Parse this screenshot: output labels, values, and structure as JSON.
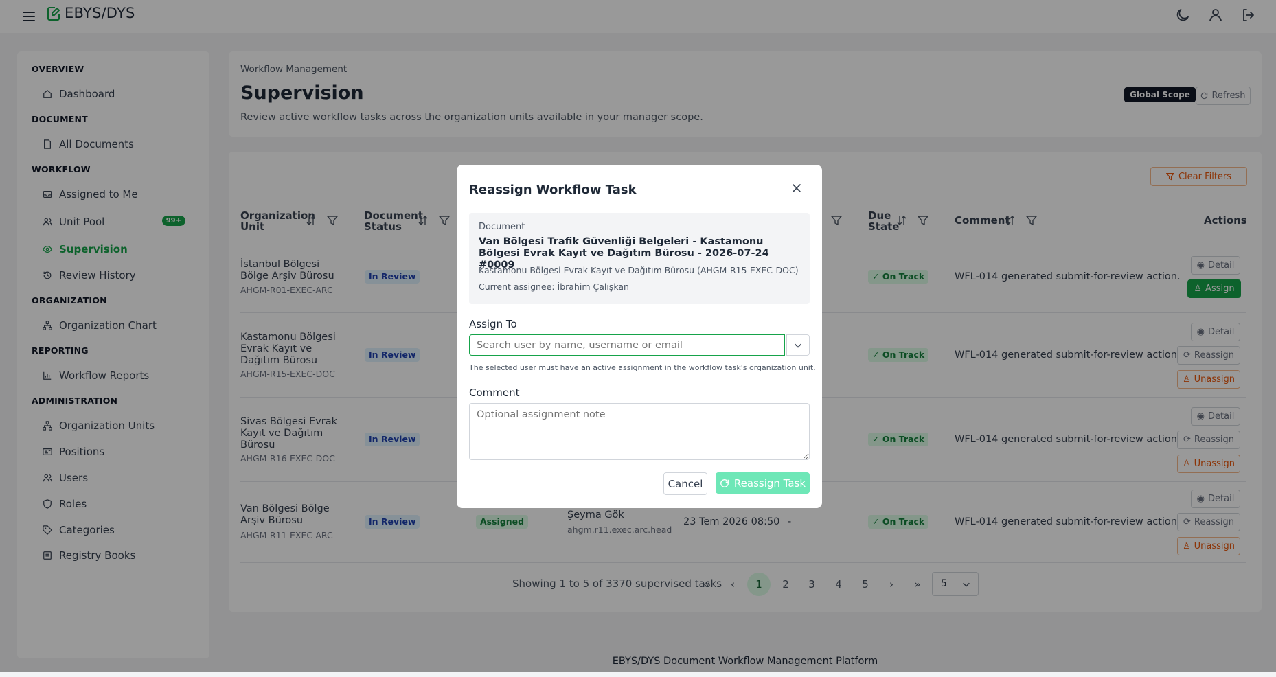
{
  "app": {
    "title": "EBYS/DYS"
  },
  "sidebar": {
    "sections": [
      {
        "title": "OVERVIEW"
      },
      {
        "title": "DOCUMENT"
      },
      {
        "title": "WORKFLOW"
      },
      {
        "title": "ORGANIZATION"
      },
      {
        "title": "REPORTING"
      },
      {
        "title": "ADMINISTRATION"
      }
    ],
    "items": [
      {
        "label": "Dashboard",
        "icon": "home-icon"
      },
      {
        "label": "All Documents",
        "icon": "document-icon"
      },
      {
        "label": "Assigned to Me",
        "icon": "inbox-icon"
      },
      {
        "label": "Unit Pool",
        "icon": "users-icon",
        "badge": "99+"
      },
      {
        "label": "Supervision",
        "icon": "eye-icon",
        "active": true
      },
      {
        "label": "Review History",
        "icon": "history-icon"
      },
      {
        "label": "Organization Chart",
        "icon": "org-chart-icon"
      },
      {
        "label": "Workflow Reports",
        "icon": "bar-chart-icon"
      },
      {
        "label": "Organization Units",
        "icon": "org-chart-icon"
      },
      {
        "label": "Positions",
        "icon": "id-card-icon"
      },
      {
        "label": "Users",
        "icon": "users-icon"
      },
      {
        "label": "Roles",
        "icon": "shield-icon"
      },
      {
        "label": "Categories",
        "icon": "tag-icon"
      },
      {
        "label": "Registry Books",
        "icon": "book-icon"
      }
    ]
  },
  "page": {
    "breadcrumb": "Workflow Management",
    "title": "Supervision",
    "description": "Review active workflow tasks across the organization units available in your manager scope.",
    "scope_badge": "Global Scope",
    "refresh_label": "Refresh",
    "clear_filters_label": "Clear Filters"
  },
  "table": {
    "columns": {
      "org_unit": "Organization Unit",
      "doc_status": "Document Status",
      "due_state": "Due State",
      "comment": "Comment",
      "actions": "Actions"
    },
    "rows": [
      {
        "unit": "İstanbul Bölgesi Bölge Arşiv Bürosu",
        "code": "AHGM-R01-EXEC-ARC",
        "doc_status": "In Review",
        "due_state": "On Track",
        "comment": "WFL-014 generated submit-for-review action.",
        "actions": [
          "Detail",
          "Assign"
        ]
      },
      {
        "unit": "Kastamonu Bölgesi Evrak Kayıt ve Dağıtım Bürosu",
        "code": "AHGM-R15-EXEC-DOC",
        "doc_status": "In Review",
        "due_state": "On Track",
        "comment": "WFL-014 generated submit-for-review action.",
        "actions": [
          "Detail",
          "Reassign",
          "Unassign"
        ]
      },
      {
        "unit": "Sivas Bölgesi Evrak Kayıt ve Dağıtım Bürosu",
        "code": "AHGM-R16-EXEC-DOC",
        "doc_status": "In Review",
        "due_state": "On Track",
        "comment": "WFL-014 generated submit-for-review action.",
        "actions": [
          "Detail",
          "Reassign",
          "Unassign"
        ]
      },
      {
        "unit": "Van Bölgesi Bölge Arşiv Bürosu",
        "code": "AHGM-R11-EXEC-ARC",
        "doc_status": "In Review",
        "task_status": "Assigned",
        "assignee": "Şeyma Gök",
        "assignee_username": "ahgm.r11.exec.arc.head",
        "due_date": "23 Tem 2026 08:50",
        "dash": "-",
        "due_state": "On Track",
        "comment": "WFL-014 generated submit-for-review action.",
        "actions": [
          "Detail",
          "Reassign",
          "Unassign"
        ]
      }
    ]
  },
  "pagination": {
    "summary": "Showing 1 to 5 of 3370 supervised tasks",
    "first": "«",
    "prev": "‹",
    "pages": [
      "1",
      "2",
      "3",
      "4",
      "5"
    ],
    "next": "›",
    "last": "»",
    "per_page": "5"
  },
  "footer": {
    "text": "EBYS/DYS Document Workflow Management Platform"
  },
  "modal": {
    "title": "Reassign Workflow Task",
    "document_label": "Document",
    "document_title": "Van Bölgesi Trafik Güvenliği Belgeleri - Kastamonu Bölgesi Evrak Kayıt ve Dağıtım Bürosu - 2026-07-24 #0009",
    "document_unit": "Kastamonu Bölgesi Evrak Kayıt ve Dağıtım Bürosu (AHGM-R15-EXEC-DOC)",
    "current_assignee": "Current assignee: İbrahim Çalışkan",
    "assign_to_label": "Assign To",
    "assign_placeholder": "Search user by name, username or email",
    "assign_hint": "The selected user must have an active assignment in the workflow task's organization unit.",
    "comment_label": "Comment",
    "comment_placeholder": "Optional assignment note",
    "cancel_label": "Cancel",
    "submit_label": "Reassign Task"
  },
  "colors": {
    "accent": "#16a34a",
    "warning": "#ea580c",
    "info": "#1e40af"
  }
}
